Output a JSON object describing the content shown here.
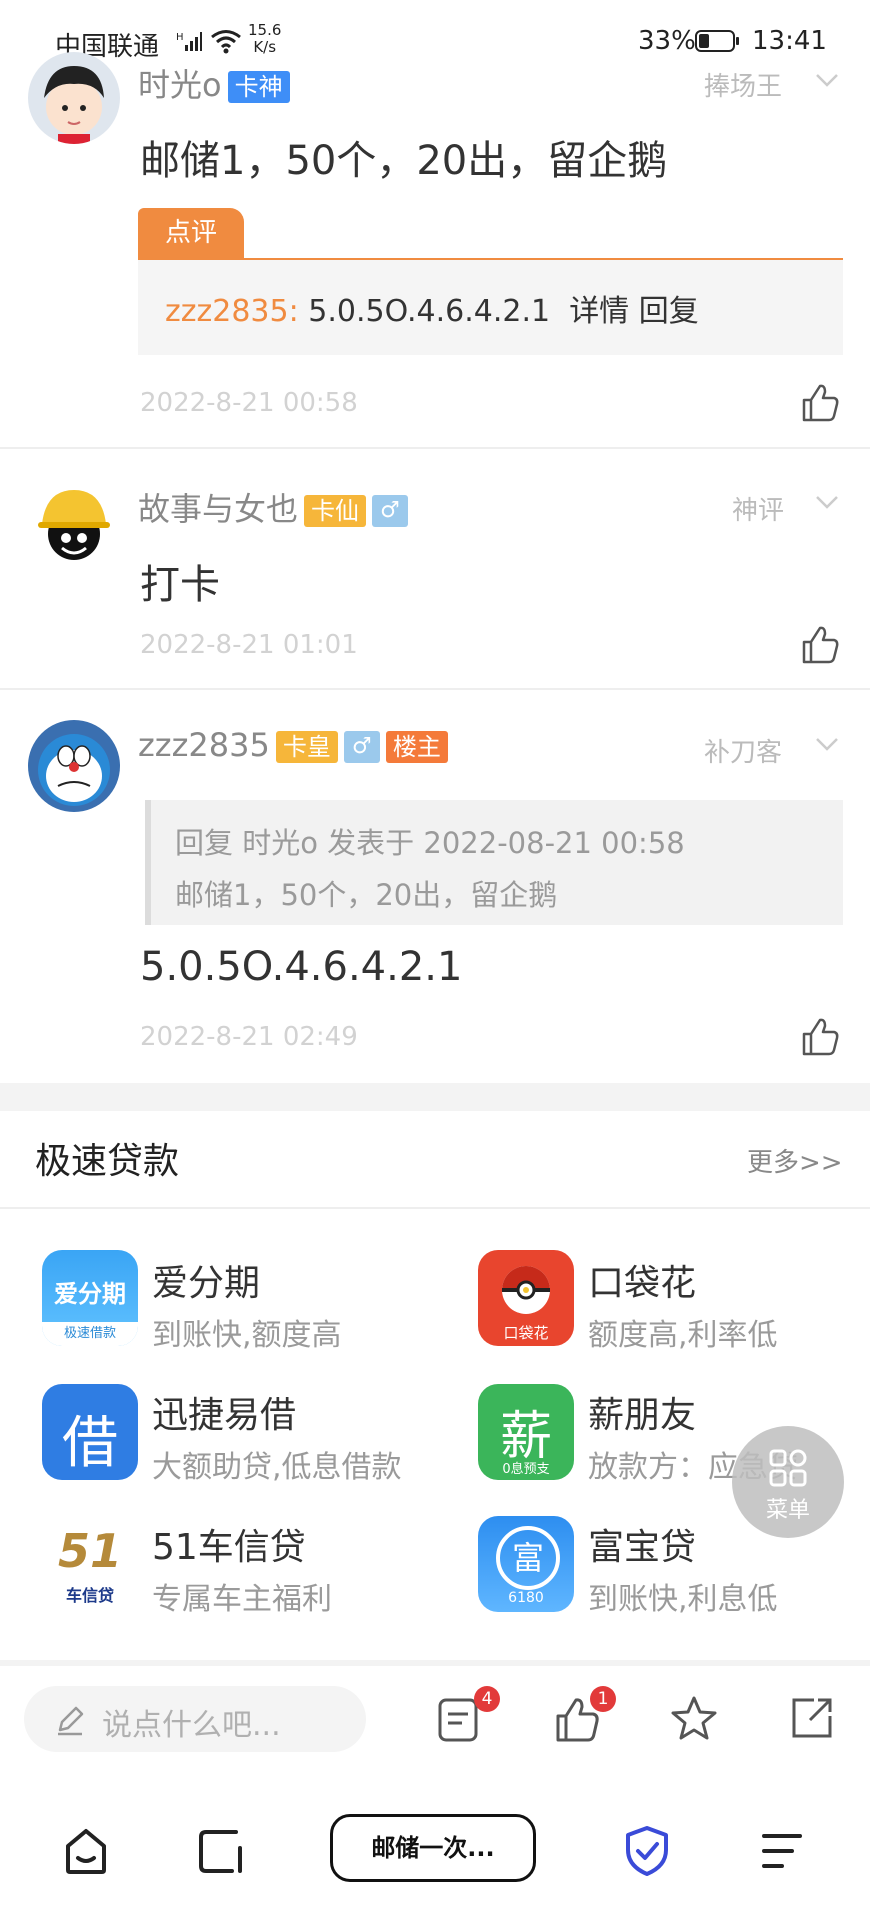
{
  "status_bar": {
    "carrier": "中国联通",
    "net_speed_value": "15.6",
    "net_speed_unit": "K/s",
    "battery_pct": "33%",
    "battery_level": 0.33,
    "time": "13:41"
  },
  "posts": [
    {
      "username": "时光o",
      "badges": [
        "卡神"
      ],
      "rank": "捧场王",
      "content": "邮储1，50个，20出，留企鹅",
      "review": {
        "tag": "点评",
        "author": "zzz2835:",
        "text": "5.0.5O.4.6.4.2.1",
        "detail_link": "详情",
        "reply_link": "回复"
      },
      "date": "2022-8-21 00:58"
    },
    {
      "username": "故事与女也",
      "badges": [
        "卡仙",
        "♂"
      ],
      "rank": "神评",
      "content": "打卡",
      "date": "2022-8-21 01:01"
    },
    {
      "username": "zzz2835",
      "badges": [
        "卡皇",
        "♂",
        "楼主"
      ],
      "rank": "补刀客",
      "quote": {
        "line1": "回复 时光o 发表于 2022-08-21 00:58",
        "line2": "邮储1，50个，20出，留企鹅"
      },
      "content": "5.0.5O.4.6.4.2.1",
      "date": "2022-8-21 02:49"
    }
  ],
  "loans": {
    "title": "极速贷款",
    "more": "更多>>",
    "items": [
      {
        "name": "爱分期",
        "desc": "到账快,额度高",
        "icon_text": "爱分期",
        "icon_sub": "极速借款"
      },
      {
        "name": "口袋花",
        "desc": "额度高,利率低",
        "icon_text": "口袋花"
      },
      {
        "name": "迅捷易借",
        "desc": "大额助贷,低息借款",
        "icon_text": "借"
      },
      {
        "name": "薪朋友",
        "desc": "放款方：应急贷",
        "icon_text": "薪",
        "icon_sub": "0息预支"
      },
      {
        "name": "51车信贷",
        "desc": "专属车主福利",
        "icon_text": "51",
        "icon_sub": "车信贷"
      },
      {
        "name": "富宝贷",
        "desc": "到账快,利息低",
        "icon_text": "富",
        "icon_sub": "6180"
      }
    ]
  },
  "float_menu": {
    "label": "菜单"
  },
  "comment_bar": {
    "placeholder": "说点什么吧...",
    "comments_count": "4",
    "likes_count": "1"
  },
  "bottom_nav": {
    "title_pill": "邮储一次..."
  },
  "colors": {
    "accent_orange": "#f08b40",
    "badge_blue": "#3e8ef7",
    "badge_yellow": "#f6b63a",
    "badge_red": "#f47a3a",
    "notify_red": "#e23a3a",
    "shield_blue": "#3a4bd8"
  }
}
